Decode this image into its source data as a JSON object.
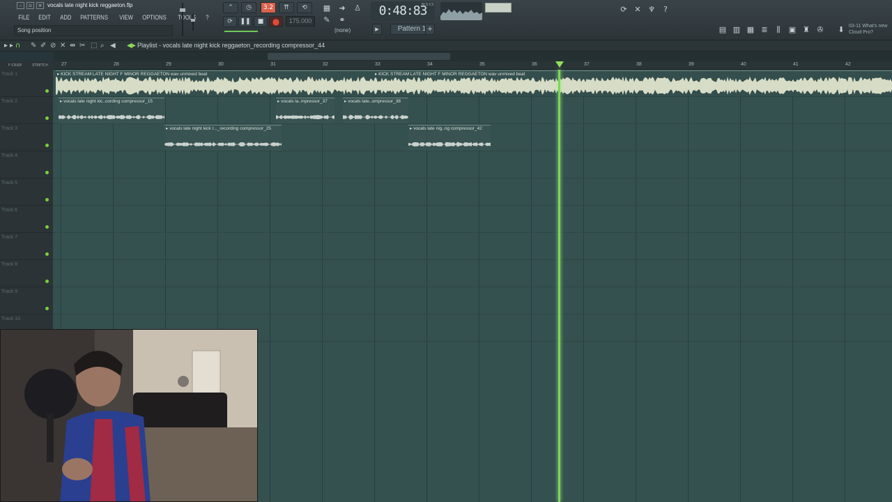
{
  "window": {
    "file_title": "vocals late night kick reggaeton.flp"
  },
  "menu": [
    "FILE",
    "EDIT",
    "ADD",
    "PATTERNS",
    "VIEW",
    "OPTIONS",
    "TOOLS",
    "?"
  ],
  "hint_bar": "Song position",
  "transport": {
    "tempo": "175.000",
    "time": "0:48:83",
    "time_unit": "M:S:CS",
    "step_mode": "3.2",
    "pattern": "Pattern 1",
    "mixer_target": "(none)"
  },
  "news": {
    "line1": "03-11  What's new",
    "line2": "Cloud Pro?"
  },
  "playlist": {
    "title": "Playlist - vocals late night kick reggaeton_recording compressor_44",
    "snap_label": "F-CRISP",
    "stretch_label": "STRETCH",
    "bars": [
      "27",
      "28",
      "29",
      "30",
      "31",
      "32",
      "33",
      "34",
      "35",
      "36",
      "37",
      "38",
      "39",
      "40",
      "41",
      "42"
    ],
    "tracks": [
      "Track 1",
      "Track 2",
      "Track 3",
      "Track 4",
      "Track 5",
      "Track 6",
      "Track 7",
      "Track 8",
      "Track 9",
      "Track 10"
    ],
    "clips": [
      {
        "label": "KICK STREAM LATE NIGHT F MINOR REGGAETON wav unmixed beat",
        "track": 0
      },
      {
        "label": "KICK STREAM LATE NIGHT F MINOR REGGAETON wav unmixed beat",
        "track": 0
      },
      {
        "label": "vocals late night kic..cording compressor_15",
        "track": 1
      },
      {
        "label": "vocals la..mpressor_37",
        "track": 1
      },
      {
        "label": "vocals late..ompressor_38",
        "track": 1
      },
      {
        "label": "vocals late night kick r..._recording compressor_25",
        "track": 2
      },
      {
        "label": "vocals late nig..ng compressor_42",
        "track": 2
      }
    ]
  },
  "colors": {
    "playhead": "#7ed55a",
    "grid_bg": "#34504f",
    "record": "#e04a3a"
  }
}
